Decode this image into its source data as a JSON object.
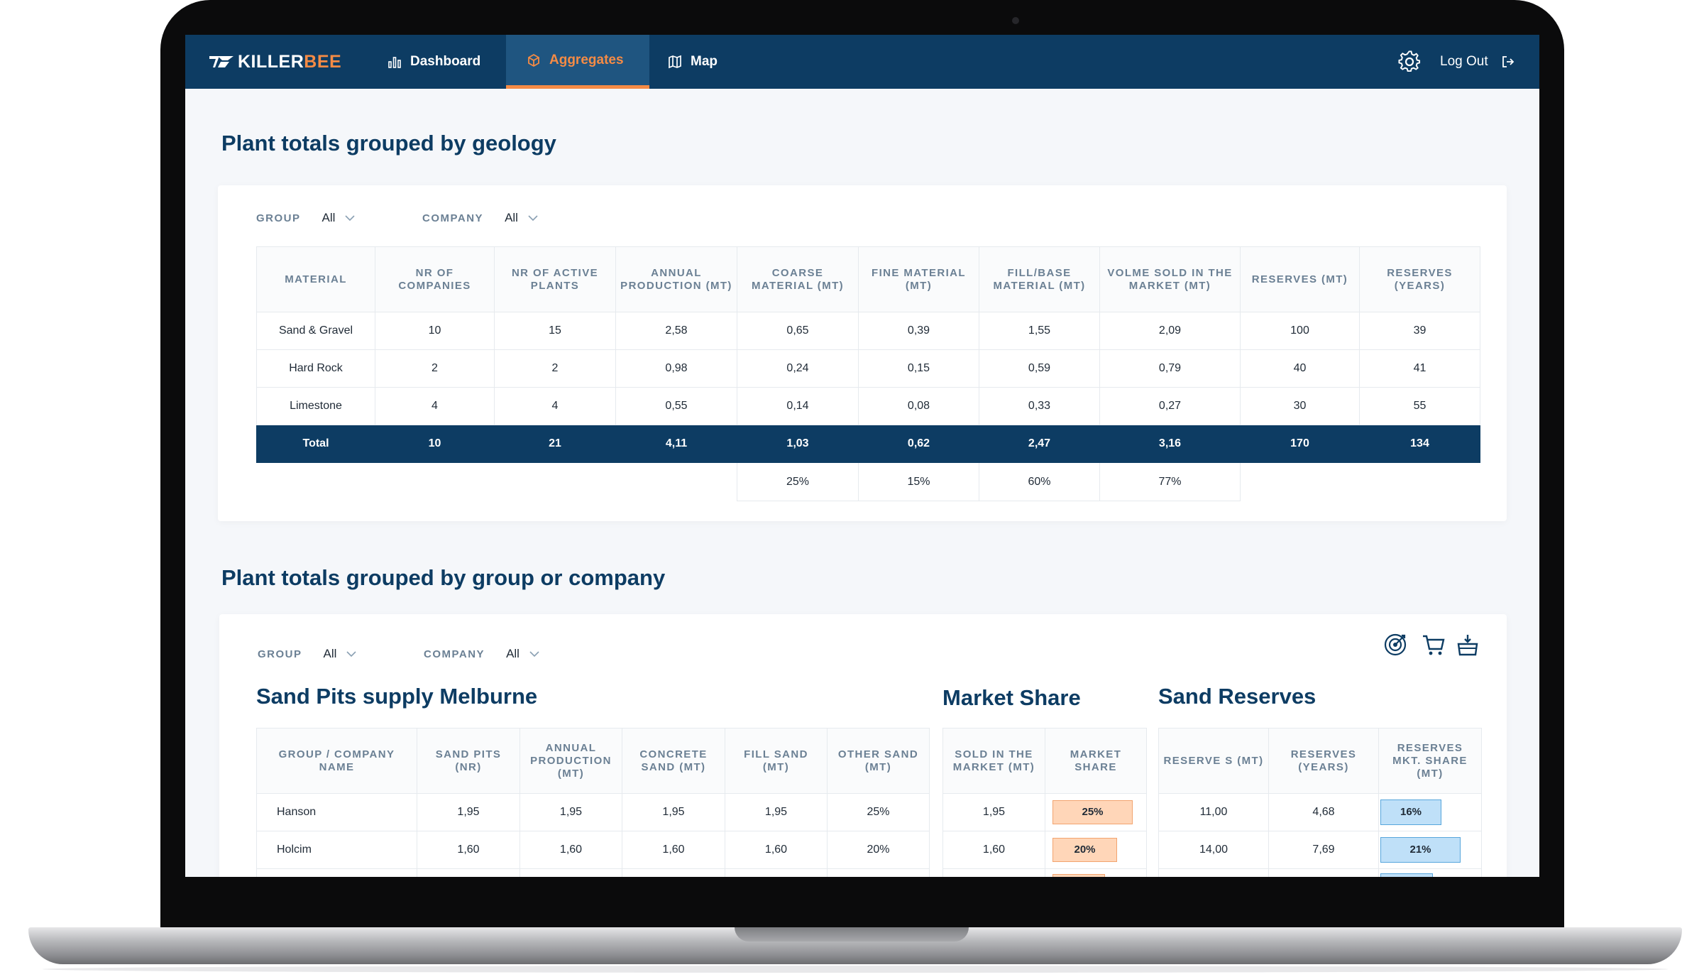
{
  "nav": {
    "brand_prefix": "KILLER",
    "brand_suffix": "BEE",
    "items": [
      {
        "label": "Dashboard",
        "icon": "bar-chart-icon",
        "active": false
      },
      {
        "label": "Aggregates",
        "icon": "cube-icon",
        "active": true
      },
      {
        "label": "Map",
        "icon": "map-icon",
        "active": false
      }
    ],
    "logout_label": "Log Out"
  },
  "geology": {
    "title": "Plant totals grouped by geology",
    "filters": {
      "group_label": "GROUP",
      "group_value": "All",
      "company_label": "COMPANY",
      "company_value": "All"
    },
    "columns": [
      "MATERIAL",
      "NR OF COMPANIES",
      "NR OF ACTIVE PLANTS",
      "ANNUAL PRODUCTION (MT)",
      "COARSE MATERIAL (MT)",
      "FINE MATERIAL (MT)",
      "FILL/BASE MATERIAL (MT)",
      "VOLME SOLD IN THE MARKET (MT)",
      "RESERVES (MT)",
      "RESERVES (YEARS)"
    ],
    "rows": [
      [
        "Sand & Gravel",
        "10",
        "15",
        "2,58",
        "0,65",
        "0,39",
        "1,55",
        "2,09",
        "100",
        "39"
      ],
      [
        "Hard Rock",
        "2",
        "2",
        "0,98",
        "0,24",
        "0,15",
        "0,59",
        "0,79",
        "40",
        "41"
      ],
      [
        "Limestone",
        "4",
        "4",
        "0,55",
        "0,14",
        "0,08",
        "0,33",
        "0,27",
        "30",
        "55"
      ]
    ],
    "total": [
      "Total",
      "10",
      "21",
      "4,11",
      "1,03",
      "0,62",
      "2,47",
      "3,16",
      "170",
      "134"
    ],
    "percents": [
      "25%",
      "15%",
      "60%",
      "77%"
    ]
  },
  "company": {
    "title": "Plant totals grouped by group or company",
    "filters": {
      "group_label": "GROUP",
      "group_value": "All",
      "company_label": "COMPANY",
      "company_value": "All"
    },
    "toolbar_icons": [
      "target-icon",
      "cart-icon",
      "basket-icon"
    ],
    "supply": {
      "title": "Sand Pits supply Melburne",
      "columns": [
        "GROUP / COMPANY NAME",
        "SAND PITS (NR)",
        "ANNUAL PRODUCTION (MT)",
        "CONCRETE SAND (MT)",
        "FILL SAND (MT)",
        "OTHER SAND (MT)"
      ],
      "rows": [
        [
          "Hanson",
          "1,95",
          "1,95",
          "1,95",
          "1,95",
          "25%"
        ],
        [
          "Holcim",
          "1,60",
          "1,60",
          "1,60",
          "1,60",
          "20%"
        ]
      ]
    },
    "market": {
      "title": "Market Share",
      "columns": [
        "SOLD IN THE MARKET (MT)",
        "MARKET SHARE"
      ],
      "rows": [
        {
          "sold": "1,95",
          "share": "25%",
          "share_value": 25
        },
        {
          "sold": "1,60",
          "share": "20%",
          "share_value": 20
        }
      ]
    },
    "reserves": {
      "title": "Sand Reserves",
      "columns": [
        "RESERVE S (MT)",
        "RESERVES (YEARS)",
        "RESERVES MKT. SHARE (MT)"
      ],
      "rows": [
        {
          "mt": "11,00",
          "years": "4,68",
          "share": "16%",
          "share_value": 16
        },
        {
          "mt": "14,00",
          "years": "7,69",
          "share": "21%",
          "share_value": 21
        }
      ]
    }
  },
  "colors": {
    "navy": "#0d3c63",
    "accent": "#f58b45",
    "orange_fill": "#ffd6b8",
    "blue_fill": "#bfe0f8"
  }
}
